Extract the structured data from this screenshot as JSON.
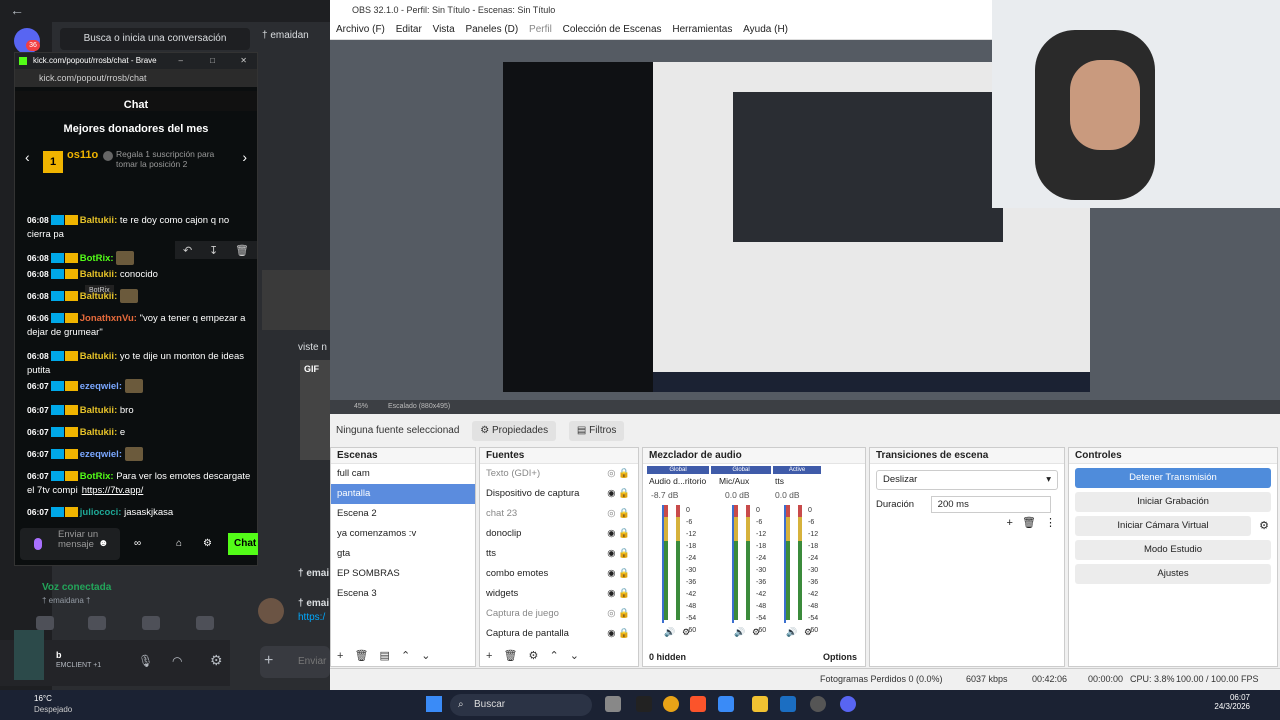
{
  "discord": {
    "search_placeholder": "Busca o inicia una conversación",
    "server_badge": "36",
    "top_user": "† emaidan",
    "voice_status": "Voz conectada",
    "voice_channel": "† emaidana †",
    "user_tag": "EMCLIENT +1",
    "msg1": "† emai",
    "msg2": "† emai",
    "msg_link": "https:/",
    "viste": "viste n",
    "gif": "GIF",
    "input_hint": "Enviar"
  },
  "popup": {
    "url_title": "kick.com/popout/rrosb/chat - Brave",
    "url": "kick.com/popout/rrosb/chat",
    "chat_title": "Chat",
    "donors_title": "Mejores donadores del mes",
    "top_donor": "os11o",
    "top_donor_rank": "1",
    "gift_text": "Regala 1 suscripción para tomar la posición 2",
    "tooltip": "BotRix",
    "input_placeholder": "Enviar un mensaje",
    "send_label": "Chat"
  },
  "chat": [
    {
      "ts": "06:08",
      "user": "Baltukii",
      "text": "te re doy como cajon q no cierra pa",
      "cls": "u-y"
    },
    {
      "ts": "06:08",
      "user": "BotRix",
      "text": "",
      "cls": "u-g"
    },
    {
      "ts": "06:08",
      "user": "Baltukii",
      "text": "conocido",
      "cls": "u-y"
    },
    {
      "ts": "06:08",
      "user": "Baltukii",
      "text": "",
      "cls": "u-y"
    },
    {
      "ts": "06:06",
      "user": "JonathxnVu",
      "text": "\"voy a tener q empezar a dejar de grumear\"",
      "cls": "u-o"
    },
    {
      "ts": "06:08",
      "user": "Baltukii",
      "text": "yo te dije un monton de ideas putita",
      "cls": "u-y"
    },
    {
      "ts": "06:07",
      "user": "ezeqwiel",
      "text": "",
      "cls": "u-b"
    },
    {
      "ts": "06:07",
      "user": "Baltukii",
      "text": "bro",
      "cls": "u-y"
    },
    {
      "ts": "06:07",
      "user": "Baltukii",
      "text": "e",
      "cls": "u-y"
    },
    {
      "ts": "06:07",
      "user": "ezeqwiel",
      "text": "",
      "cls": "u-b"
    },
    {
      "ts": "06:07",
      "user": "BotRix",
      "text": "Para ver los emotes descargate el 7tv compi",
      "link": "https://7tv.app/",
      "cls": "u-g"
    },
    {
      "ts": "06:07",
      "user": "juliococi",
      "text": "jasaskjkasa",
      "cls": "u-t"
    }
  ],
  "obs": {
    "title": "OBS 32.1.0 - Perfil: Sin Título - Escenas: Sin Título",
    "menu": [
      "Archivo (F)",
      "Editar",
      "Vista",
      "Paneles (D)",
      "Perfil",
      "Colección de Escenas",
      "Herramientas",
      "Ayuda (H)"
    ],
    "zoom": "45%",
    "scale": "Escalado (880x495)",
    "no_source": "Ninguna fuente seleccionad",
    "properties": "Propiedades",
    "filters": "Filtros",
    "scenes_title": "Escenas",
    "scenes": [
      "full cam",
      "pantalla",
      "Escena 2",
      "ya comenzamos :v",
      "gta",
      "EP SOMBRAS",
      "Escena 3"
    ],
    "selected_scene": 1,
    "sources_title": "Fuentes",
    "sources": [
      "Texto (GDI+)",
      "Dispositivo de captura",
      "chat 23",
      "donoclip",
      "tts",
      "combo emotes",
      "widgets",
      "Captura de juego",
      "Captura de pantalla"
    ],
    "mixer_title": "Mezclador de audio",
    "mixer_channels": [
      {
        "name": "Audio d...ritorio",
        "db": "-8.7 dB",
        "tag": "Global"
      },
      {
        "name": "Mic/Aux",
        "db": "0.0 dB",
        "tag": "Global"
      },
      {
        "name": "tts",
        "db": "0.0 dB",
        "tag": "Active"
      }
    ],
    "scale_marks": [
      "0",
      "-6",
      "-12",
      "-18",
      "-24",
      "-30",
      "-36",
      "-42",
      "-48",
      "-54",
      "-60"
    ],
    "hidden": "0 hidden",
    "options": "Options",
    "transitions_title": "Transiciones de escena",
    "transition": "Deslizar",
    "duration_label": "Duración",
    "duration": "200 ms",
    "controls_title": "Controles",
    "controls": [
      "Detener Transmisión",
      "Iniciar Grabación",
      "Iniciar Cámara Virtual",
      "Modo Estudio",
      "Ajustes"
    ],
    "status": {
      "frames": "Fotogramas Perdidos 0 (0.0%)",
      "kbps": "6037 kbps",
      "live": "00:42:06",
      "rec": "00:00:00",
      "cpu": "CPU: 3.8%",
      "fps": "100.00 / 100.00 FPS"
    }
  },
  "taskbar": {
    "weather_temp": "16°C",
    "weather": "Despejado",
    "search": "Buscar",
    "time": "06:07",
    "date": "24/3/2026"
  }
}
